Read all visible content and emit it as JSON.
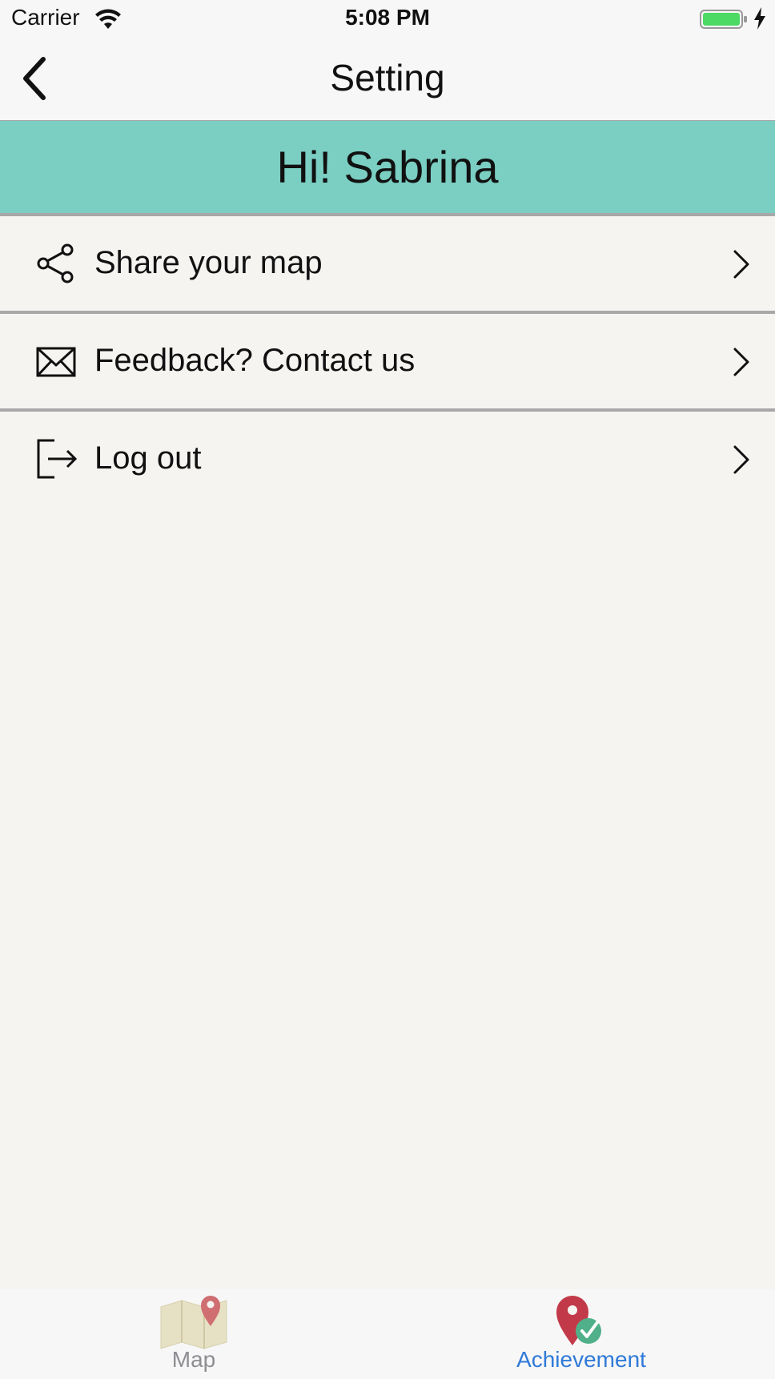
{
  "status_bar": {
    "carrier": "Carrier",
    "time": "5:08 PM",
    "battery_color": "#4cd964"
  },
  "nav": {
    "title": "Setting",
    "back_icon": "chevron-left-icon"
  },
  "greeting": {
    "text": "Hi! Sabrina",
    "background": "#7acec2"
  },
  "menu": {
    "items": [
      {
        "label": "Share your map",
        "icon": "share-icon"
      },
      {
        "label": "Feedback? Contact us",
        "icon": "mail-icon"
      },
      {
        "label": "Log out",
        "icon": "logout-icon"
      }
    ]
  },
  "tab_bar": {
    "tabs": [
      {
        "label": "Map",
        "icon": "map-icon",
        "selected": false
      },
      {
        "label": "Achievement",
        "icon": "achievement-pin-icon",
        "selected": true
      }
    ],
    "selected_color": "#2f7ad8",
    "unselected_color": "#8e8e93"
  }
}
